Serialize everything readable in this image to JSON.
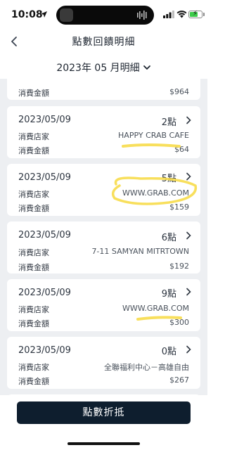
{
  "status": {
    "time": "10:08"
  },
  "header": {
    "title": "點數回饋明細",
    "back_icon": "chevron-left-icon"
  },
  "month": {
    "label": "2023年 05 月明細"
  },
  "labels": {
    "store": "消費店家",
    "amount": "消費金額"
  },
  "partial_card": {
    "amount": "$964"
  },
  "cards": [
    {
      "date": "2023/05/09",
      "points": "2點",
      "store": "HAPPY CRAB CAFE",
      "amount": "$64"
    },
    {
      "date": "2023/05/09",
      "points": "5點",
      "store": "WWW.GRAB.COM",
      "amount": "$159"
    },
    {
      "date": "2023/05/09",
      "points": "6點",
      "store": "7-11 SAMYAN MITRTOWN",
      "amount": "$192"
    },
    {
      "date": "2023/05/09",
      "points": "9點",
      "store": "WWW.GRAB.COM",
      "amount": "$300"
    },
    {
      "date": "2023/05/09",
      "points": "0點",
      "store": "全聯福利中心－高雄自由",
      "amount": "$267"
    }
  ],
  "footer": {
    "redeem_label": "點數折抵"
  },
  "colors": {
    "highlight": "#f7dc4a",
    "button": "#0e1e2e",
    "list_bg": "#edeff2"
  }
}
